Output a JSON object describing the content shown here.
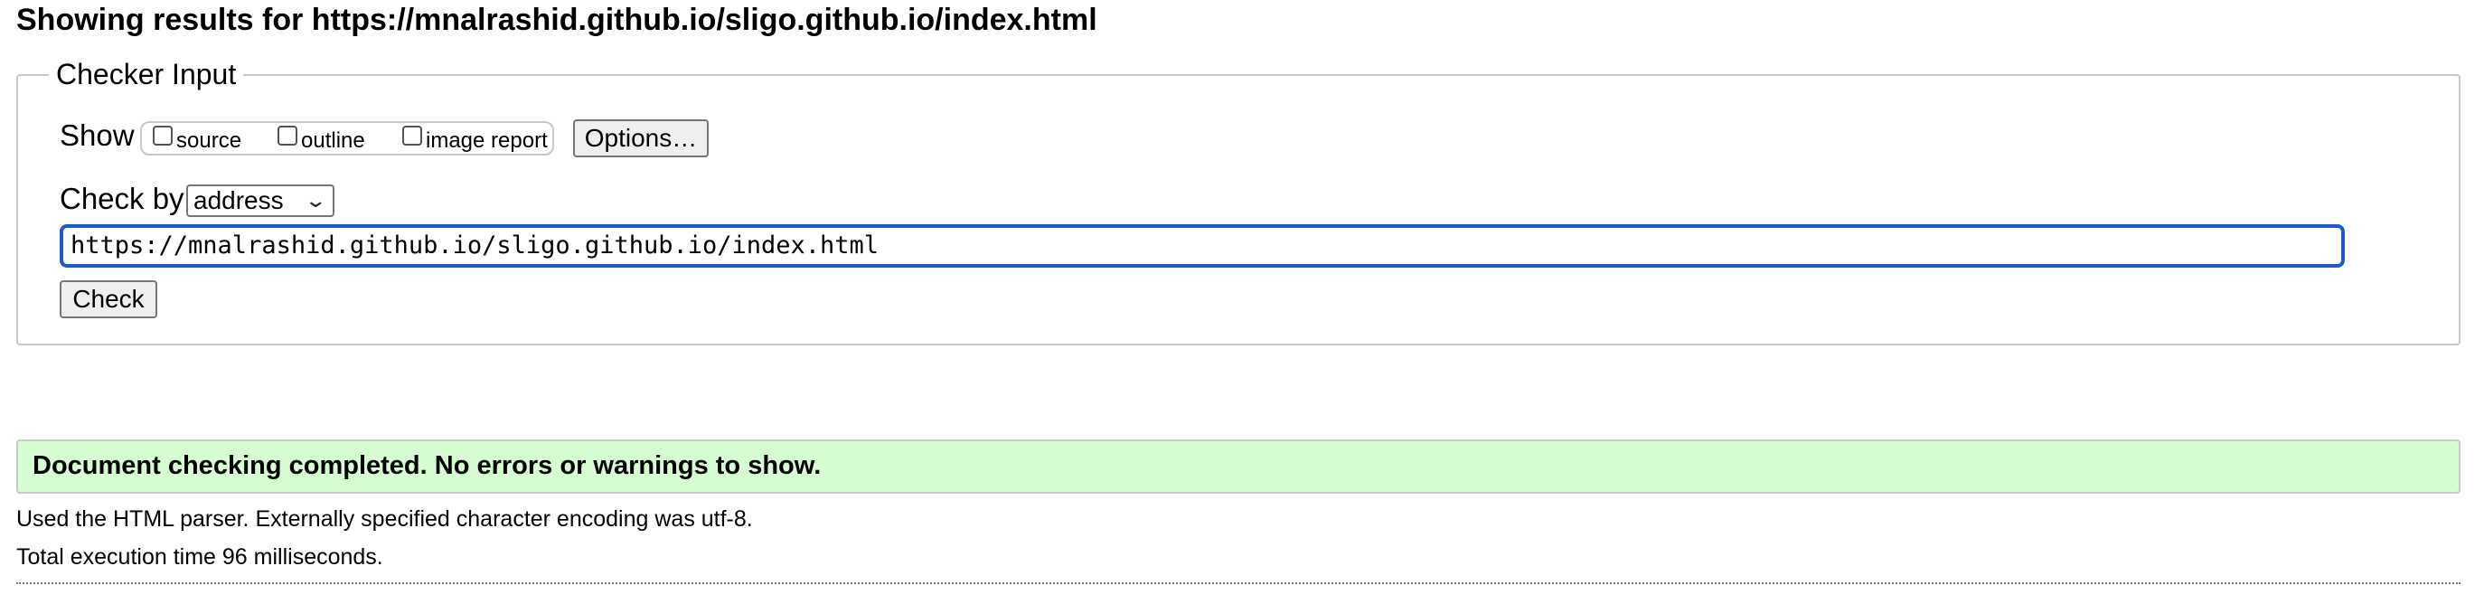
{
  "header": {
    "title": "Showing results for https://mnalrashid.github.io/sligo.github.io/index.html"
  },
  "checker_input": {
    "legend": "Checker Input",
    "show_label": "Show",
    "options": {
      "source": {
        "label": "source",
        "checked": false
      },
      "outline": {
        "label": "outline",
        "checked": false
      },
      "image_report": {
        "label": "image report",
        "checked": false
      }
    },
    "options_button": "Options…",
    "check_by_label": "Check by",
    "check_by_value": "address",
    "url_value": "https://mnalrashid.github.io/sligo.github.io/index.html",
    "check_button": "Check"
  },
  "results": {
    "success_message": "Document checking completed. No errors or warnings to show.",
    "parser_info": "Used the HTML parser. Externally specified character encoding was utf-8.",
    "execution_time": "Total execution time 96 milliseconds."
  },
  "colors": {
    "success_bg": "#d6fcd2",
    "focus_border": "#1a5bd1",
    "fieldset_border": "#c8c8c8"
  }
}
